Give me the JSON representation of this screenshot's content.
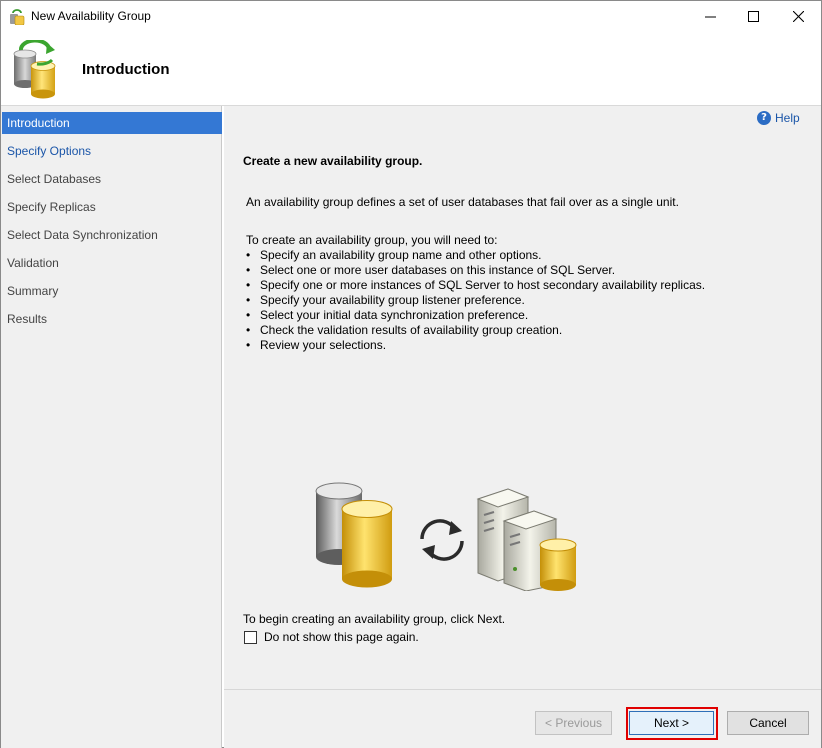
{
  "window": {
    "title": "New Availability Group",
    "controls": {
      "minimize": "minimize",
      "maximize": "maximize",
      "close": "close"
    }
  },
  "header": {
    "title": "Introduction"
  },
  "nav": {
    "items": [
      {
        "label": "Introduction",
        "state": "active"
      },
      {
        "label": "Specify Options",
        "state": "link"
      },
      {
        "label": "Select Databases",
        "state": "disabled"
      },
      {
        "label": "Specify Replicas",
        "state": "disabled"
      },
      {
        "label": "Select Data Synchronization",
        "state": "disabled"
      },
      {
        "label": "Validation",
        "state": "disabled"
      },
      {
        "label": "Summary",
        "state": "disabled"
      },
      {
        "label": "Results",
        "state": "disabled"
      }
    ]
  },
  "main": {
    "help_label": "Help",
    "heading": "Create a new availability group.",
    "description": "An availability group defines a set of user databases that fail over as a single unit.",
    "steps_intro": "To create an availability group, you will need to:",
    "steps": [
      "Specify an availability group name and other options.",
      "Select one or more user databases on this instance of SQL Server.",
      "Specify one or more instances of SQL Server to host secondary availability replicas.",
      "Specify your availability group listener preference.",
      "Select your initial data synchronization preference.",
      "Check the validation results of availability group creation.",
      "Review your selections."
    ],
    "begin_text": "To begin creating an availability group, click Next.",
    "dont_show_label": "Do not show this page again.",
    "dont_show_checked": false
  },
  "buttons": {
    "previous": "< Previous",
    "next": "Next >",
    "cancel": "Cancel"
  },
  "colors": {
    "accent": "#3478d4",
    "link": "#1a55a8",
    "highlight": "#e00000"
  }
}
